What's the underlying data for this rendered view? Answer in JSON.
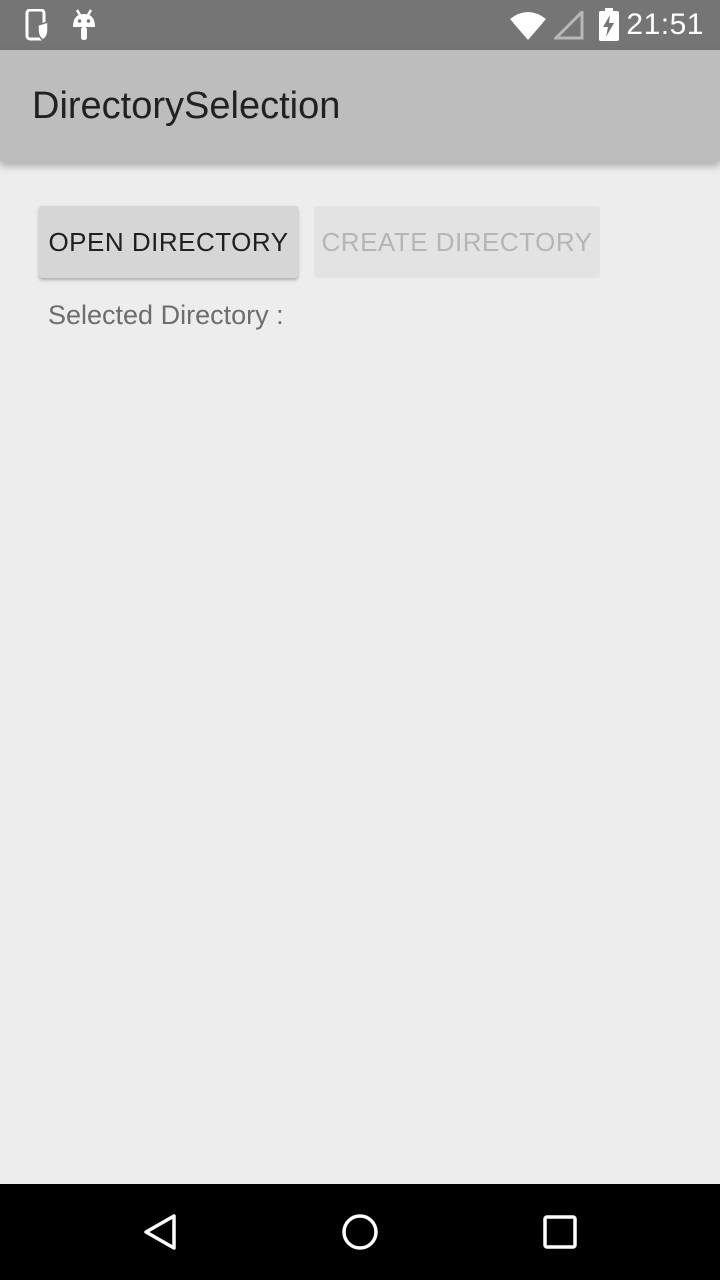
{
  "status_bar": {
    "time": "21:51",
    "icons": [
      "phone-shield-icon",
      "android-icon",
      "wifi-icon",
      "signal-icon",
      "battery-charging-icon"
    ]
  },
  "app_bar": {
    "title": "DirectorySelection"
  },
  "main": {
    "open_button_label": "OPEN DIRECTORY",
    "create_button_label": "CREATE DIRECTORY",
    "selected_directory_label": "Selected Directory :"
  },
  "nav_bar": {
    "icons": [
      "back-icon",
      "home-icon",
      "recents-icon"
    ]
  },
  "colors": {
    "status_bar": "#757575",
    "app_bar": "#bdbdbd",
    "background": "#ededed",
    "nav_bar": "#000000"
  }
}
